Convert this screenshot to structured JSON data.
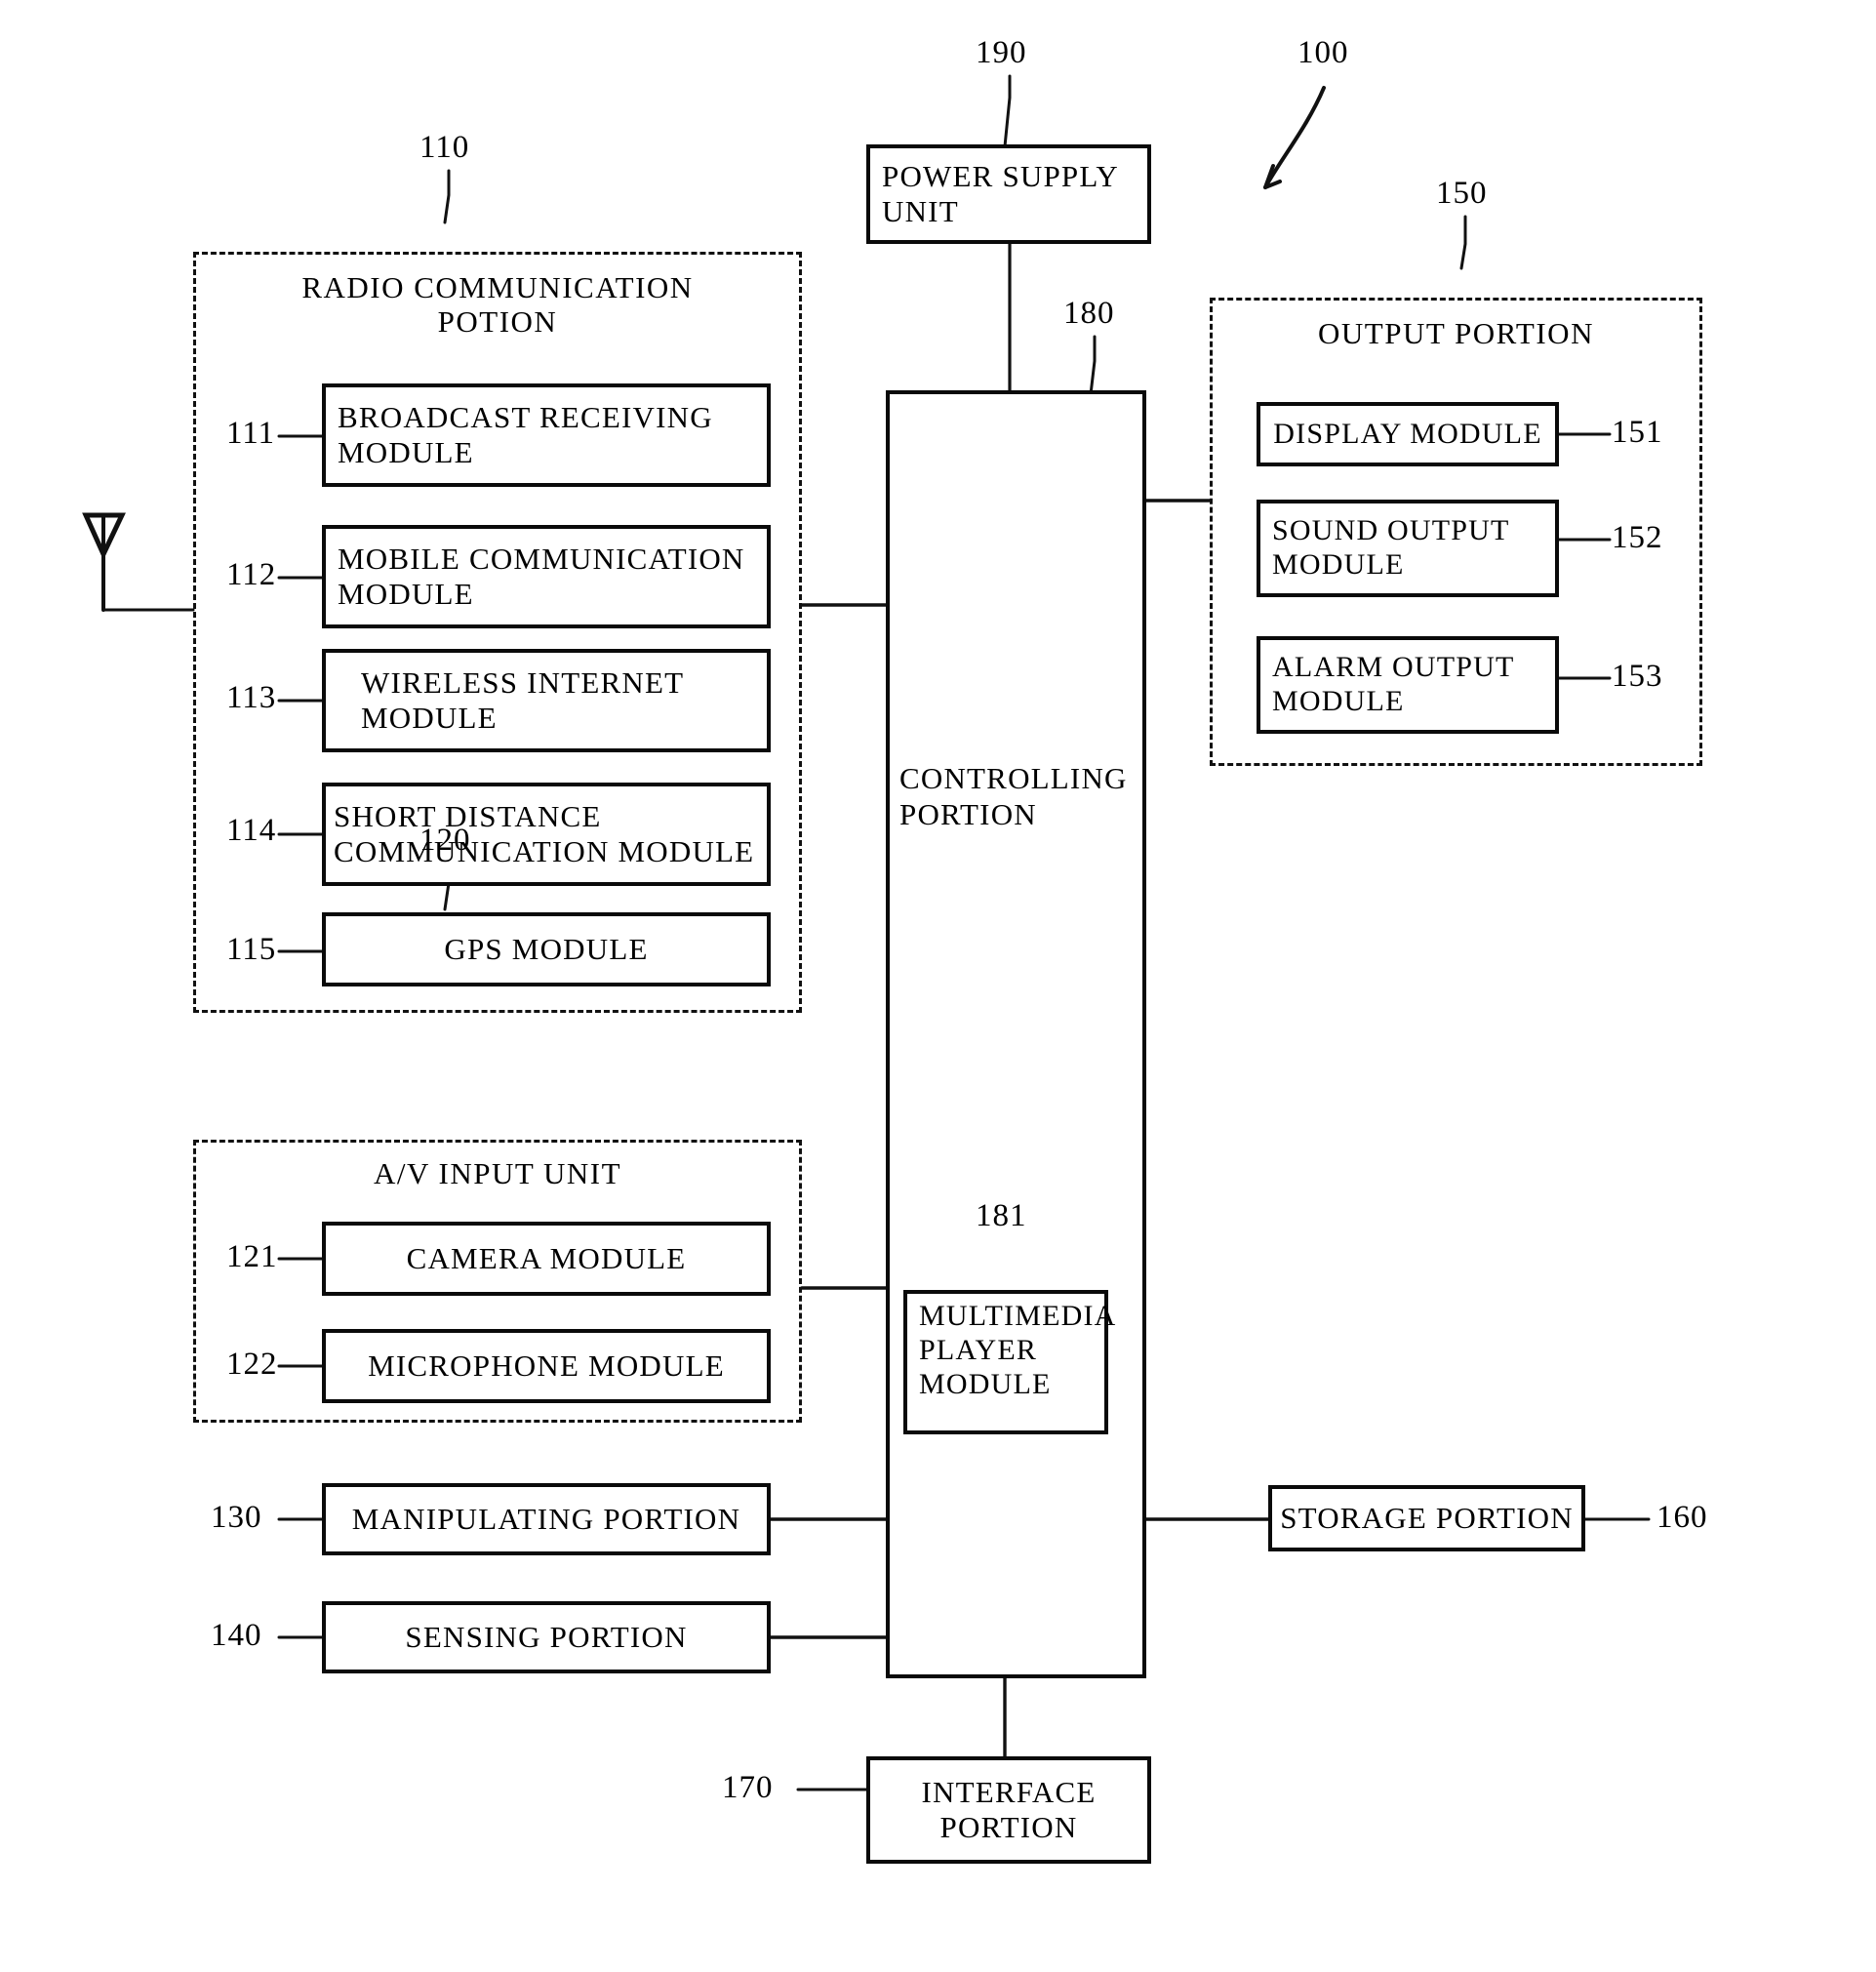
{
  "figure": {
    "type": "patent-block-diagram",
    "system_numeral": "100"
  },
  "power_supply": {
    "label": "POWER SUPPLY\nUNIT",
    "numeral": "190"
  },
  "controller": {
    "label": "CONTROLLING\nPORTION",
    "numeral": "180",
    "submodule": {
      "label": "MULTIMEDIA\nPLAYER\nMODULE",
      "numeral": "181"
    }
  },
  "radio_group": {
    "title": "RADIO COMMUNICATION\nPOTION",
    "numeral": "110",
    "modules": [
      {
        "numeral": "111",
        "label": "BROADCAST RECEIVING\nMODULE"
      },
      {
        "numeral": "112",
        "label": "MOBILE COMMUNICATION\nMODULE"
      },
      {
        "numeral": "113",
        "label": "WIRELESS INTERNET\nMODULE"
      },
      {
        "numeral": "114",
        "label": "SHORT DISTANCE\nCOMMUNICATION MODULE"
      },
      {
        "numeral": "115",
        "label": "GPS MODULE"
      }
    ]
  },
  "av_group": {
    "title": "A/V INPUT UNIT",
    "numeral": "120",
    "modules": [
      {
        "numeral": "121",
        "label": "CAMERA MODULE"
      },
      {
        "numeral": "122",
        "label": "MICROPHONE MODULE"
      }
    ]
  },
  "output_group": {
    "title": "OUTPUT PORTION",
    "numeral": "150",
    "modules": [
      {
        "numeral": "151",
        "label": "DISPLAY MODULE"
      },
      {
        "numeral": "152",
        "label": "SOUND OUTPUT\nMODULE"
      },
      {
        "numeral": "153",
        "label": "ALARM OUTPUT\nMODULE"
      }
    ]
  },
  "standalone": [
    {
      "numeral": "130",
      "label": "MANIPULATING PORTION"
    },
    {
      "numeral": "140",
      "label": "SENSING PORTION"
    },
    {
      "numeral": "160",
      "label": "STORAGE PORTION"
    },
    {
      "numeral": "170",
      "label": "INTERFACE\nPORTION"
    }
  ],
  "icons": {
    "antenna": "antenna-icon"
  }
}
